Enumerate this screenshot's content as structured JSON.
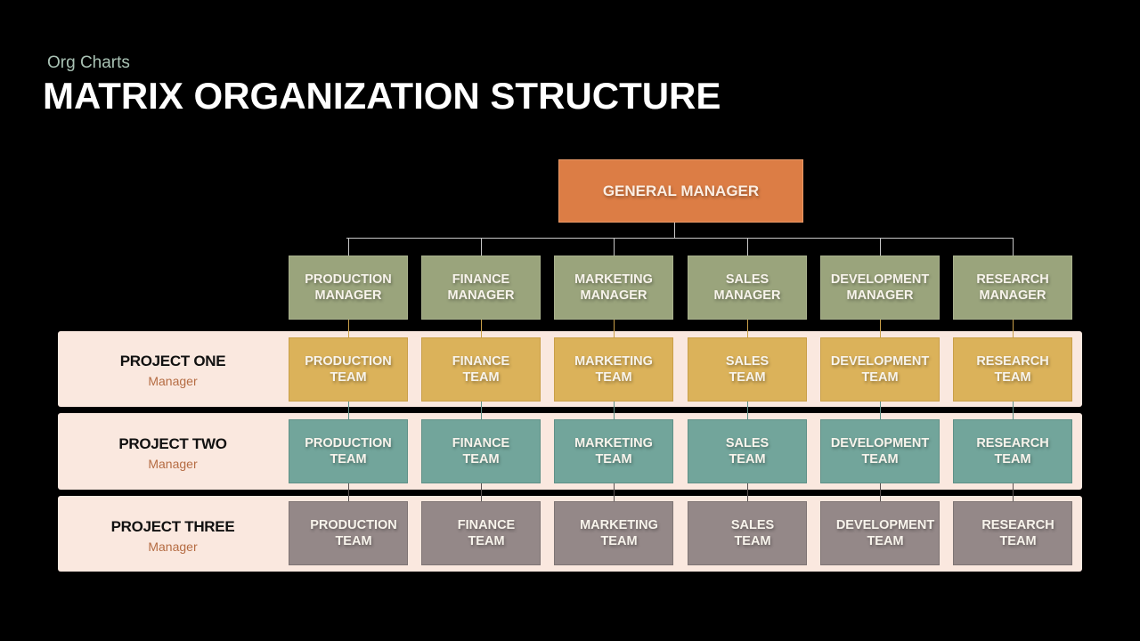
{
  "header": {
    "subtitle": "Org Charts",
    "title": "MATRIX ORGANIZATION STRUCTURE"
  },
  "top": {
    "label": "GENERAL MANAGER",
    "color": "#dc7d45"
  },
  "columns": [
    {
      "manager_line1": "PRODUCTION",
      "manager_line2": "MANAGER",
      "team_line1": "PRODUCTION",
      "team_line2": "TEAM"
    },
    {
      "manager_line1": "FINANCE",
      "manager_line2": "MANAGER",
      "team_line1": "FINANCE",
      "team_line2": "TEAM"
    },
    {
      "manager_line1": "MARKETING",
      "manager_line2": "MANAGER",
      "team_line1": "MARKETING",
      "team_line2": "TEAM"
    },
    {
      "manager_line1": "SALES",
      "manager_line2": "MANAGER",
      "team_line1": "SALES",
      "team_line2": "TEAM"
    },
    {
      "manager_line1": "DEVELOPMENT",
      "manager_line2": "MANAGER",
      "team_line1": "DEVELOPMENT",
      "team_line2": "TEAM"
    },
    {
      "manager_line1": "RESEARCH",
      "manager_line2": "MANAGER",
      "team_line1": "RESEARCH",
      "team_line2": "TEAM"
    }
  ],
  "projects": [
    {
      "name": "PROJECT ONE",
      "role": "Manager",
      "color": "#dbb25a"
    },
    {
      "name": "PROJECT TWO",
      "role": "Manager",
      "color": "#72a59b"
    },
    {
      "name": "PROJECT THREE",
      "role": "Manager",
      "color": "#948888"
    }
  ],
  "colors": {
    "background": "#000000",
    "manager_box": "#9aa47c",
    "row_panel": "#fae8df",
    "connector": "#c8c8c8"
  }
}
